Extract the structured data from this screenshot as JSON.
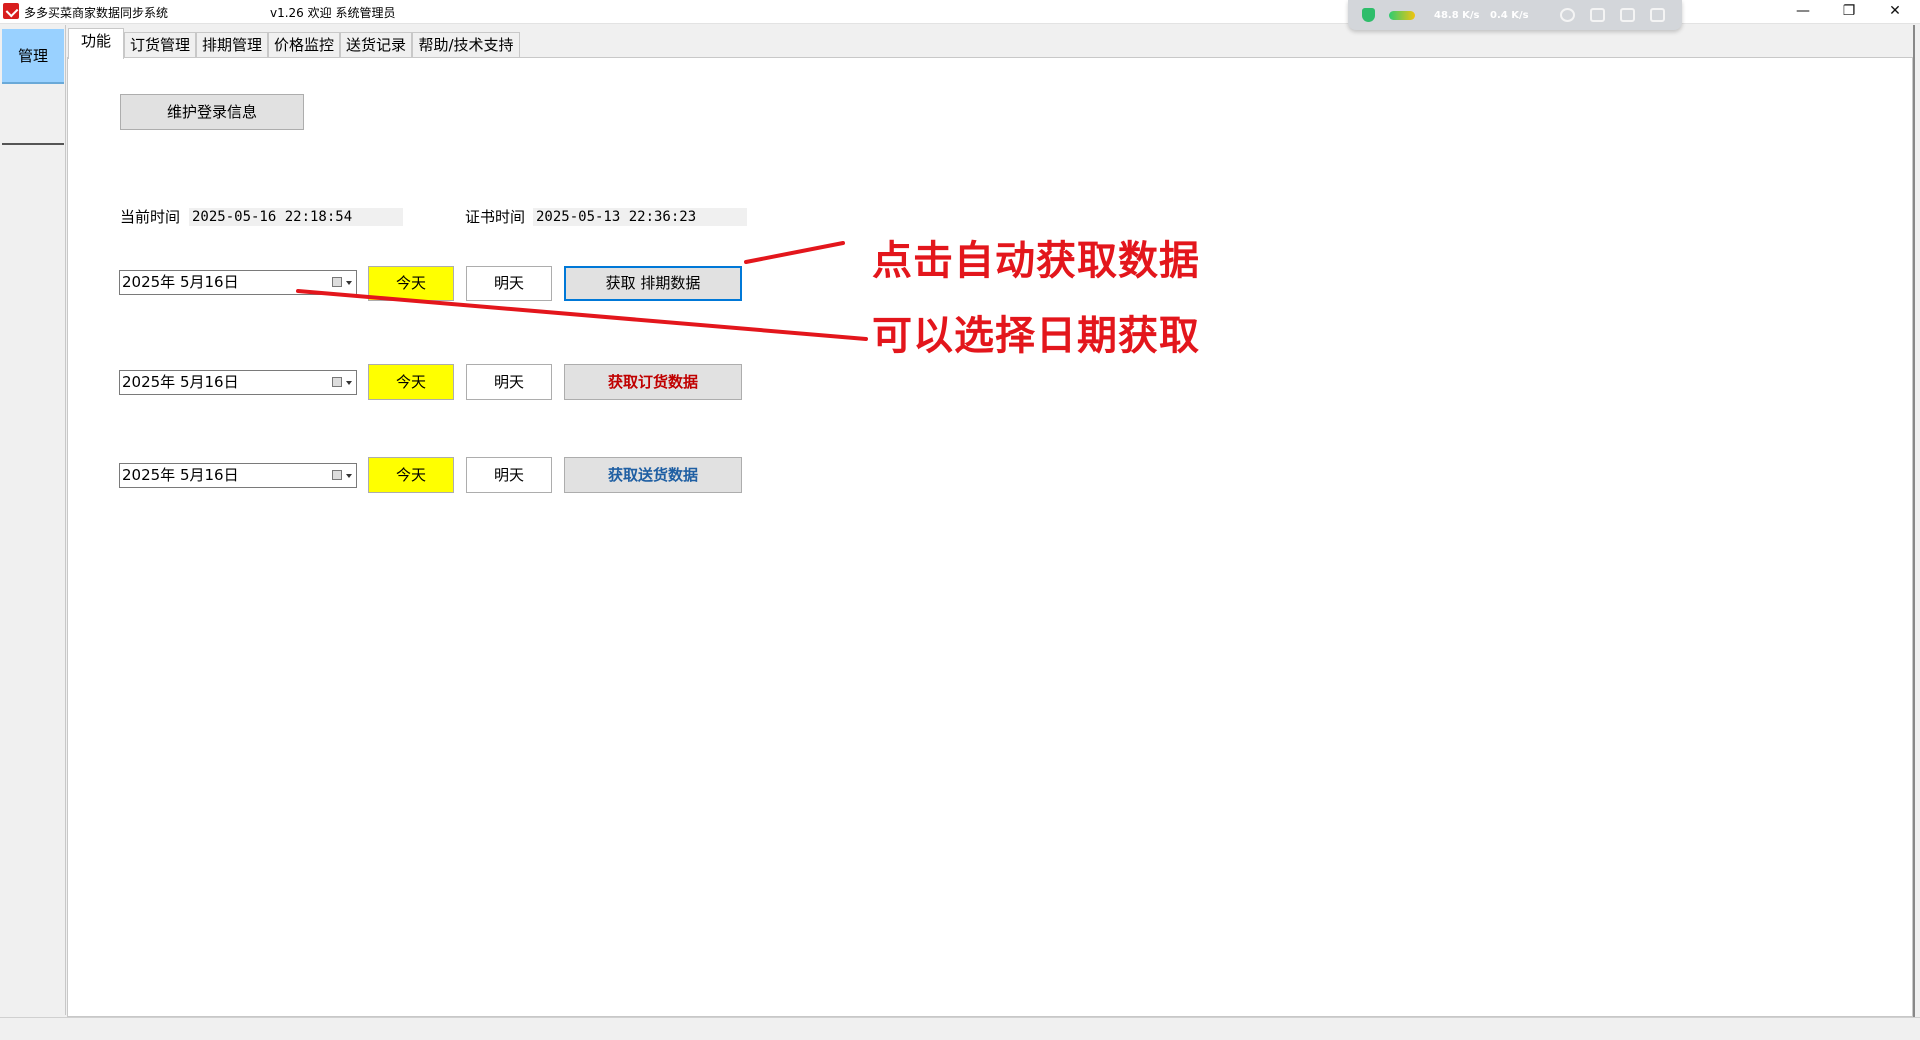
{
  "window": {
    "app_title": "多多买菜商家数据同步系统",
    "version_welcome": "v1.26  欢迎 系统管理员",
    "minimize": "—",
    "restore": "❐",
    "close": "✕"
  },
  "net_widget": {
    "upload": "48.8 K/s",
    "download": "0.4 K/s"
  },
  "sidebar": {
    "manage_label": "管理"
  },
  "tabs": [
    {
      "label": "功能"
    },
    {
      "label": "订货管理"
    },
    {
      "label": "排期管理"
    },
    {
      "label": "价格监控"
    },
    {
      "label": "送货记录"
    },
    {
      "label": "帮助/技术支持"
    }
  ],
  "main": {
    "maintain_login_label": "维护登录信息",
    "current_time_label": "当前时间",
    "current_time_value": "2025-05-16 22:18:54",
    "cert_time_label": "证书时间",
    "cert_time_value": "2025-05-13 22:36:23",
    "rows": [
      {
        "date": "2025年  5月16日",
        "today": "今天",
        "tomorrow": "明天",
        "fetch": "获取 排期数据"
      },
      {
        "date": "2025年  5月16日",
        "today": "今天",
        "tomorrow": "明天",
        "fetch": "获取订货数据"
      },
      {
        "date": "2025年  5月16日",
        "today": "今天",
        "tomorrow": "明天",
        "fetch": "获取送货数据"
      }
    ]
  },
  "annotations": {
    "line1": "点击自动获取数据",
    "line2": "可以选择日期获取",
    "color": "#e3161c"
  }
}
